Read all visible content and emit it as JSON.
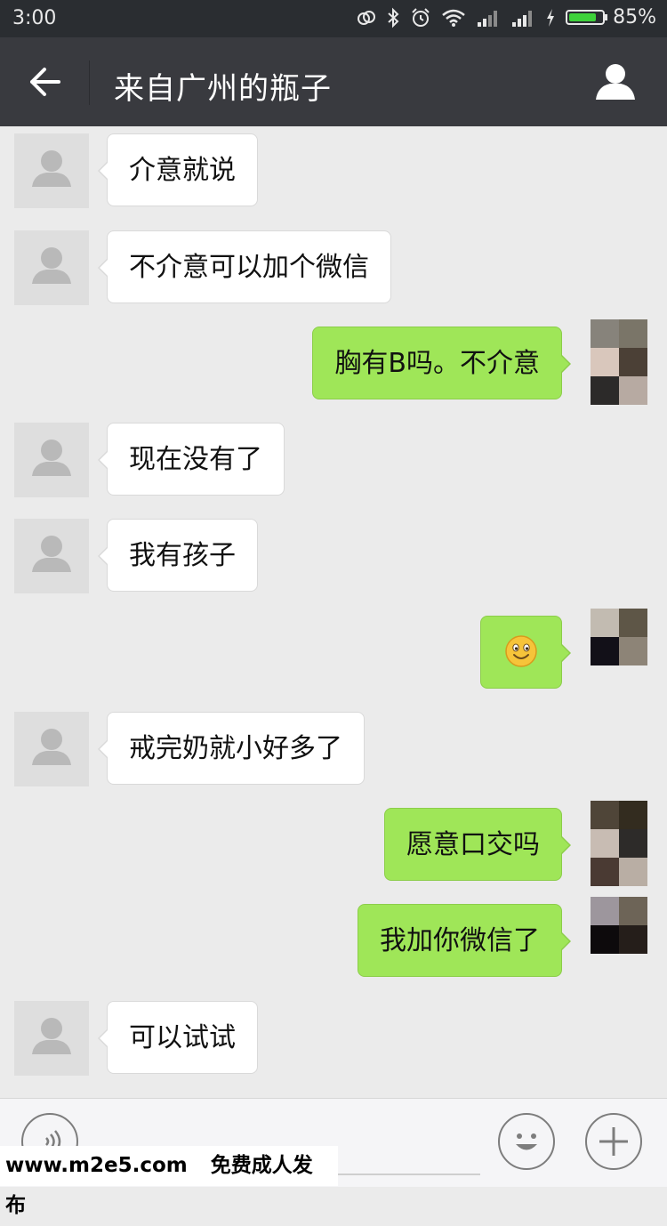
{
  "status_bar": {
    "time": "3:00",
    "battery_percent": "85%",
    "battery_level": 0.85
  },
  "header": {
    "title": "来自广州的瓶子"
  },
  "messages": [
    {
      "side": "in",
      "text": "介意就说"
    },
    {
      "side": "in",
      "text": "不介意可以加个微信"
    },
    {
      "side": "out",
      "text": "胸有B吗。不介意"
    },
    {
      "side": "in",
      "text": "现在没有了"
    },
    {
      "side": "in",
      "text": "我有孩子"
    },
    {
      "side": "out",
      "text": "",
      "emoji": "smile-emoji"
    },
    {
      "side": "in",
      "text": "戒完奶就小好多了"
    },
    {
      "side": "out",
      "text": "愿意口交吗"
    },
    {
      "side": "out",
      "text": "我加你微信了"
    },
    {
      "side": "in",
      "text": "可以试试"
    }
  ],
  "watermark": {
    "site": "www.m2e5.com",
    "slogan": "免费成人发布"
  },
  "colors": {
    "outgoing_bubble": "#9fe658",
    "incoming_bubble": "#ffffff",
    "header": "#393a3f",
    "background": "#ebebeb"
  }
}
